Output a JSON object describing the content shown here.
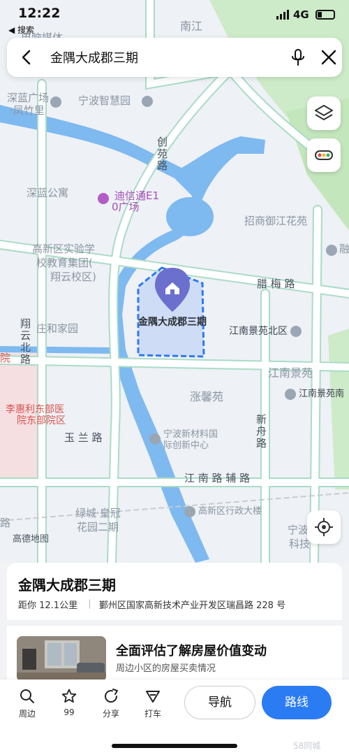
{
  "status_bar": {
    "time": "12:22",
    "back_app": "◀ 搜索",
    "network": "4G"
  },
  "search": {
    "query": "金隅大成郡三期"
  },
  "map": {
    "labels": {
      "ningbo_zhihui": "宁波智慧园",
      "shenlan_guangchang": "深蓝广场",
      "fengzhuli": "·凤竹里",
      "shenlan_gongyu": "深蓝公寓",
      "dixintong": "迪信通E1",
      "dixintong2": "0广场",
      "school1": "高新区实验学",
      "school2": "校教育集团(",
      "school3": "翔云校区)",
      "zhaoshang": "招商御江花苑",
      "lemei_road": "腊 梅 路",
      "zhuanghe": "庄和家园",
      "jiangnan_jingyuan_north": "江南景苑北区",
      "jiangnan_jingyuan": "江南景苑",
      "jiangnan_jingyuan_short": "江南景苑南",
      "zhangxin": "涨馨苑",
      "hospital1": "李惠利东部医",
      "hospital2": "院东部院区",
      "yulan_road": "玉 兰 路",
      "xincai1": "宁波新材料国",
      "xincai2": "际创新中心",
      "xinzhou_road": "新舟路",
      "jiangnan_fudao": "江 南 路 辅 路",
      "lvcheng1": "绿城·皇冠",
      "lvcheng2": "花园二期",
      "gaoxin_xingzheng": "高新区行政大楼",
      "ningbo_keji": "宁波",
      "keji2": "科技",
      "gaode": "高德地图",
      "chuangyuan_road": "创苑路",
      "xiangyun_north": "翔云北路",
      "top_partial": "电脑媒体",
      "right_partial": "融",
      "top_right_road": "南江",
      "left_partial": "院",
      "left_partial2": "路"
    },
    "aoi_name": "金隅大成郡三期",
    "accent_color": "#2b7bf3",
    "water_color": "#7eb9f0",
    "park_color": "#cdebc8"
  },
  "card": {
    "title": "金隅大成郡三期",
    "distance": "距你 12.1公里",
    "address": "鄞州区国家高新技术产业开发区瑞昌路 228 号",
    "promo_title": "全面评估了解房屋价值变动",
    "promo_sub": "周边小区的房屋买卖情况"
  },
  "toolbar": {
    "nearby": "周边",
    "favorite_count": "99",
    "share": "分享",
    "taxi": "打车",
    "navigate": "导航",
    "route": "路线"
  },
  "watermark": "58同城"
}
